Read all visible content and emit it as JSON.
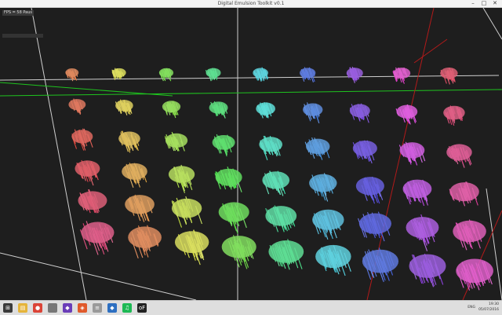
{
  "window": {
    "title": "Digital Emulsion Toolkit v0.1",
    "minimize_glyph": "–",
    "maximize_glyph": "□",
    "close_glyph": "✕"
  },
  "overlay": {
    "fps_label": "FPS = 58 Paus"
  },
  "taskbar": {
    "start_icon": "windows-start-icon",
    "apps": [
      {
        "name": "windows-start-icon",
        "color": "#3a3a3a",
        "glyph": "⊞"
      },
      {
        "name": "file-explorer-icon",
        "color": "#e5b43a",
        "glyph": "▤"
      },
      {
        "name": "chrome-icon",
        "color": "#db4437",
        "glyph": "●"
      },
      {
        "name": "blank-app-icon",
        "color": "#777777",
        "glyph": ""
      },
      {
        "name": "visual-studio-icon",
        "color": "#6a3db8",
        "glyph": "◆"
      },
      {
        "name": "git-icon",
        "color": "#e05a2b",
        "glyph": "◈"
      },
      {
        "name": "notepad-icon",
        "color": "#9a9a9a",
        "glyph": "≡"
      },
      {
        "name": "visual-studio-code-icon",
        "color": "#2d6fc1",
        "glyph": "◆"
      },
      {
        "name": "spotify-icon",
        "color": "#1db954",
        "glyph": "♫"
      },
      {
        "name": "openframeworks-icon",
        "color": "#222222",
        "glyph": "oF"
      }
    ],
    "language": "ENG",
    "time": "19:30",
    "date": "05/07/2016"
  },
  "colors": {
    "viewport_bg": "#1e1e1e",
    "axis_white": "#cfcfcf",
    "axis_green": "#1ec31e",
    "axis_red": "#b21a1a"
  }
}
